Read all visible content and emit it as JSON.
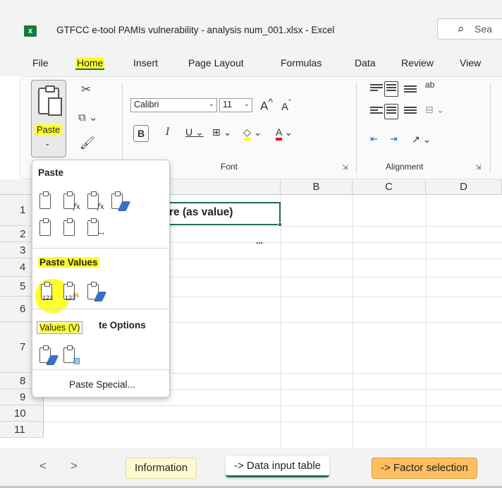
{
  "window": {
    "app_icon": "excel-icon",
    "app_icon_letter": "x",
    "title": "GTFCC e-tool PAMIs vulnerability - analysis num_001.xlsx  -  Excel",
    "search_placeholder": "Sea"
  },
  "menu": {
    "tabs": [
      "File",
      "Home",
      "Insert",
      "Page Layout",
      "Formulas",
      "Data",
      "Review",
      "View"
    ],
    "active": "Home"
  },
  "ribbon": {
    "clipboard": {
      "paste_label": "Paste"
    },
    "font": {
      "font_name": "Calibri",
      "font_size": "11",
      "grow": "A",
      "shrink": "A",
      "bold": "B",
      "italic": "I",
      "underline": "U",
      "color_letter": "A",
      "group_label": "Font"
    },
    "alignment": {
      "group_label": "Alignment",
      "wrap_text_glyph": "ab"
    }
  },
  "grid": {
    "columns": [
      "B",
      "C",
      "D"
    ],
    "rows": [
      "1",
      "2",
      "3",
      "4",
      "5",
      "6",
      "7",
      "8",
      "9",
      "10",
      "11"
    ],
    "cell_a1_text": "re (as value)",
    "cell_a2_overflow": "..."
  },
  "paste_menu": {
    "section_paste": "Paste",
    "section_values": "Paste Values",
    "section_other_partial": "te Options",
    "paste_special": "Paste Special...",
    "tooltip": "Values (V)",
    "value_icon_number": "123",
    "formula_mark": "fx"
  },
  "sheets": {
    "prev_arrow": "<",
    "next_arrow": ">",
    "tabs": [
      "Information",
      "-> Data input table",
      "-> Factor selection"
    ],
    "active": "-> Data input table"
  },
  "colors": {
    "highlight": "#ffff2e",
    "excel_green": "#1d6f42",
    "factor_tab": "#fdbf5f",
    "information_tab": "#fffbd0"
  }
}
